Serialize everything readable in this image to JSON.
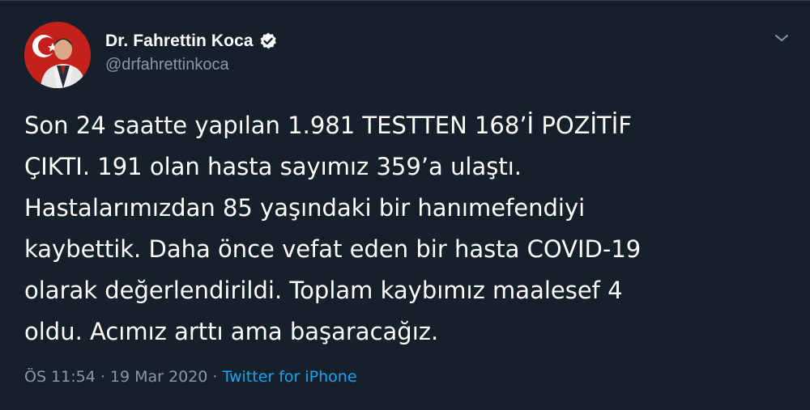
{
  "tweet": {
    "author": {
      "display_name": "Dr. Fahrettin Koca",
      "handle": "@drfahrettinkoca",
      "verified": true,
      "avatar_icon": "profile-photo"
    },
    "text_lines": [
      "Son 24 saatte yapılan 1.981 TESTTEN 168’İ POZİTİF",
      "ÇIKTI. 191 olan hasta sayımız 359’a ulaştı.",
      "Hastalarımızdan 85 yaşındaki bir hanımefendiyi",
      "kaybettik. Daha önce vefat eden bir hasta COVID-19",
      "olarak değerlendirildi. Toplam kaybımız maalesef 4",
      "oldu. Acımız arttı ama başaracağız."
    ],
    "timestamp": "ÖS 11:54 · 19 Mar 2020 ·",
    "source": "Twitter for iPhone",
    "menu_icon": "chevron-down-icon"
  },
  "colors": {
    "background": "#15202b",
    "text": "#ffffff",
    "secondary_text": "#8899a6",
    "link": "#1da1f2",
    "verified_badge": "#ffffff"
  }
}
